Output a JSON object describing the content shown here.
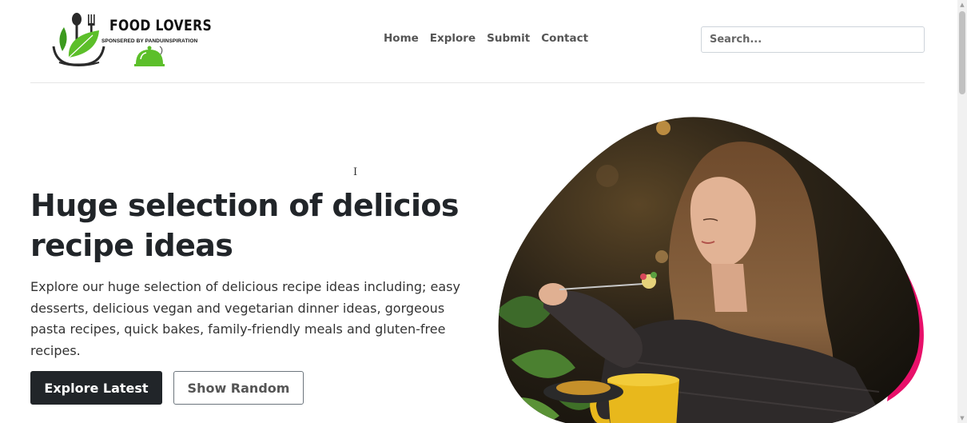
{
  "brand": {
    "name": "FOOD LOVERS",
    "tagline": "SPONSERED BY PANDUINSPIRATION",
    "logo_icon": "fork-spoon-bowl-leaf-icon",
    "accent_green": "#5cbf2a"
  },
  "nav": {
    "links": [
      {
        "label": "Home"
      },
      {
        "label": "Explore"
      },
      {
        "label": "Submit"
      },
      {
        "label": "Contact"
      }
    ]
  },
  "search": {
    "placeholder": "Search..."
  },
  "hero": {
    "title": "Huge selection of delicios recipe ideas",
    "text": "Explore our huge selection of delicious recipe ideas including; easy desserts, delicious vegan and vegetarian dinner ideas, gorgeous pasta recipes, quick bakes, family-friendly meals and gluten-free recipes.",
    "primary_button": "Explore Latest",
    "secondary_button": "Show Random",
    "image": "woman-eating-pasta-photo",
    "blob_accent": "#e8106a"
  },
  "cursor_glyph": "I"
}
